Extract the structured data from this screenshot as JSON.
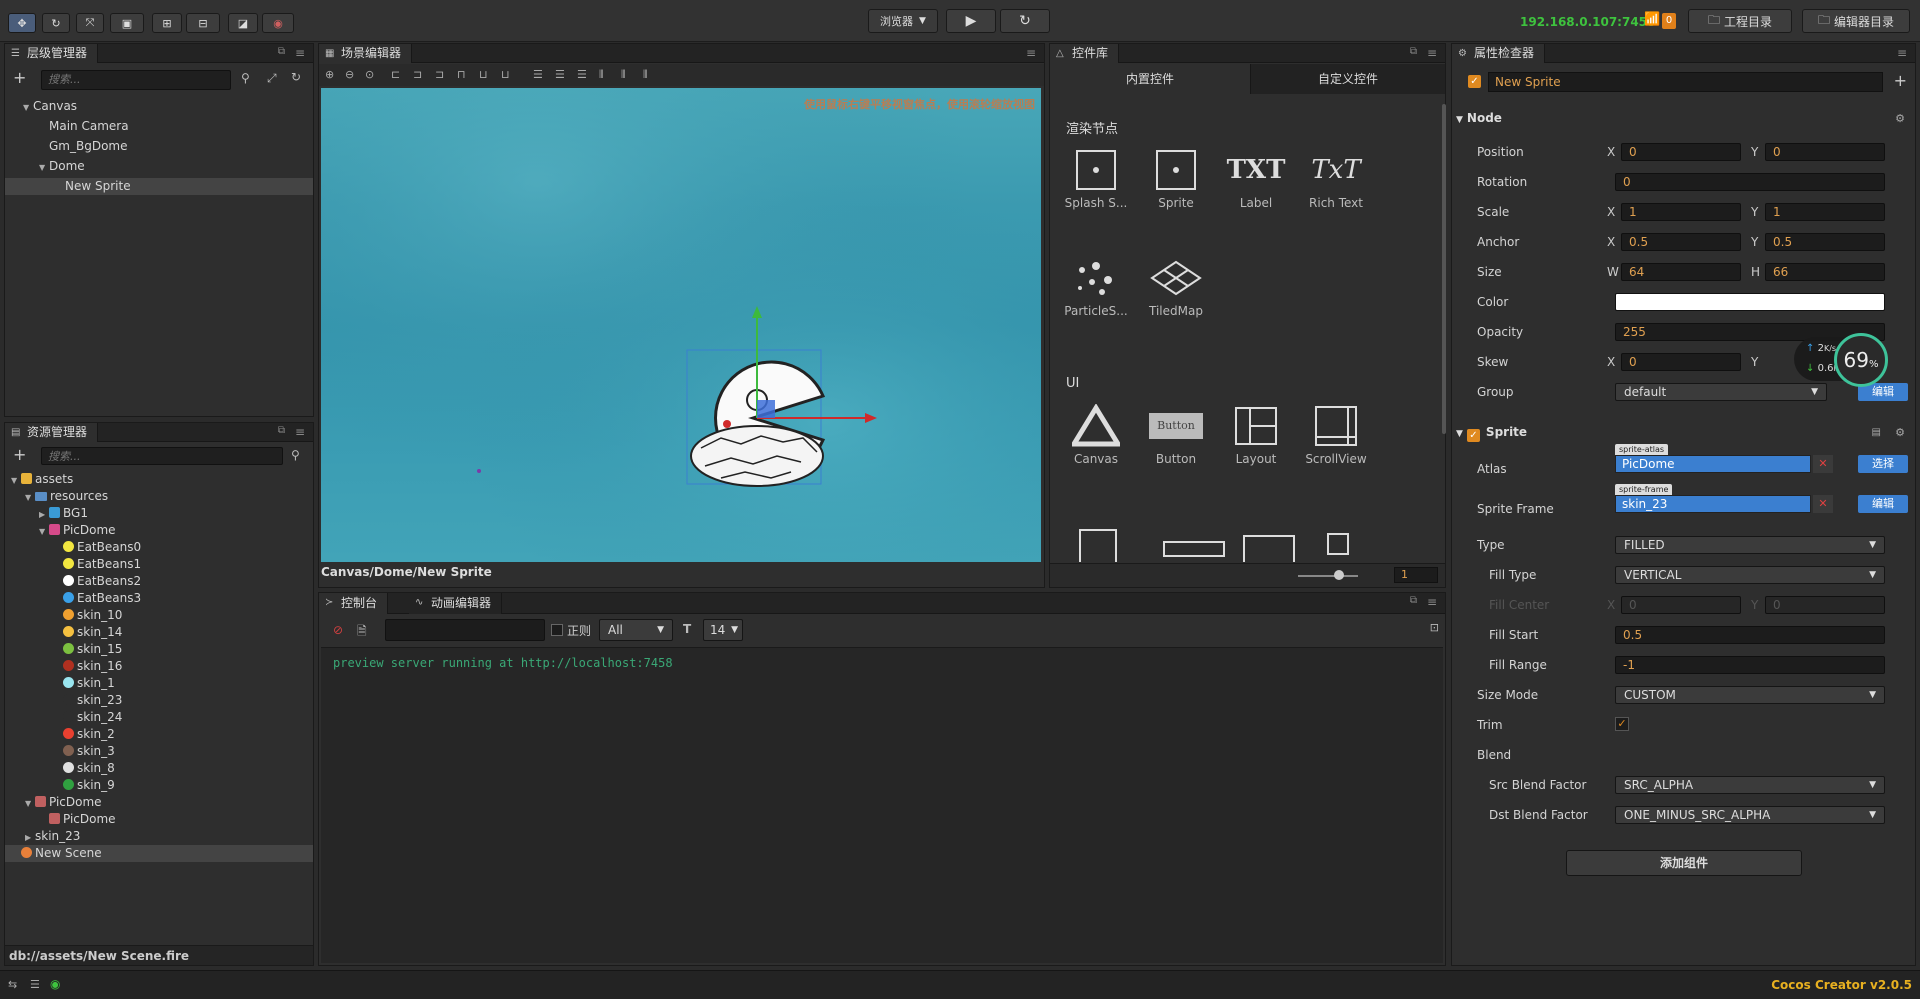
{
  "toolbar": {
    "browser_select": "浏览器",
    "ip_address": "192.168.0.107:7458",
    "notify_count": "0",
    "project_dir": "工程目录",
    "editor_dir": "编辑器目录"
  },
  "hierarchy": {
    "title": "层级管理器",
    "search_placeholder": "搜索...",
    "items": [
      {
        "label": "Canvas",
        "depth": 1,
        "arrow": "▼"
      },
      {
        "label": "Main Camera",
        "depth": 2,
        "arrow": ""
      },
      {
        "label": "Gm_BgDome",
        "depth": 2,
        "arrow": ""
      },
      {
        "label": "Dome",
        "depth": 2,
        "arrow": "▼"
      },
      {
        "label": "New Sprite",
        "depth": 3,
        "arrow": ""
      }
    ]
  },
  "assets": {
    "title": "资源管理器",
    "search_placeholder": "搜索...",
    "path": "db://assets/New Scene.fire",
    "items": [
      {
        "label": "assets",
        "depth": 0,
        "arrow": "▼",
        "icon": "db-icon",
        "color": "#e8b33a"
      },
      {
        "label": "resources",
        "depth": 1,
        "arrow": "▼",
        "icon": "folder-icon",
        "color": "#5a8fc7"
      },
      {
        "label": "BG1",
        "depth": 2,
        "arrow": "▶",
        "icon": "texture-icon",
        "color": "#3a9bd6"
      },
      {
        "label": "PicDome",
        "depth": 2,
        "arrow": "▼",
        "icon": "texture-icon",
        "color": "#d64a8a"
      },
      {
        "label": "EatBeans0",
        "depth": 3,
        "arrow": "",
        "icon": "sprite-icon",
        "color": "#f2e640"
      },
      {
        "label": "EatBeans1",
        "depth": 3,
        "arrow": "",
        "icon": "sprite-icon",
        "color": "#f2e640"
      },
      {
        "label": "EatBeans2",
        "depth": 3,
        "arrow": "",
        "icon": "sprite-icon",
        "color": "#ffffff"
      },
      {
        "label": "EatBeans3",
        "depth": 3,
        "arrow": "",
        "icon": "sprite-icon",
        "color": "#3aa0e8"
      },
      {
        "label": "skin_10",
        "depth": 3,
        "arrow": "",
        "icon": "sprite-icon",
        "color": "#f0a030"
      },
      {
        "label": "skin_14",
        "depth": 3,
        "arrow": "",
        "icon": "sprite-icon",
        "color": "#f5c040"
      },
      {
        "label": "skin_15",
        "depth": 3,
        "arrow": "",
        "icon": "sprite-icon",
        "color": "#7cc040"
      },
      {
        "label": "skin_16",
        "depth": 3,
        "arrow": "",
        "icon": "sprite-icon",
        "color": "#b03020"
      },
      {
        "label": "skin_1",
        "depth": 3,
        "arrow": "",
        "icon": "sprite-icon",
        "color": "#9ae6f0"
      },
      {
        "label": "skin_23",
        "depth": 3,
        "arrow": "",
        "icon": "sprite-icon",
        "color": "#2e2e2e"
      },
      {
        "label": "skin_24",
        "depth": 3,
        "arrow": "",
        "icon": "sprite-icon",
        "color": "#2e2e2e"
      },
      {
        "label": "skin_2",
        "depth": 3,
        "arrow": "",
        "icon": "sprite-icon",
        "color": "#e84030"
      },
      {
        "label": "skin_3",
        "depth": 3,
        "arrow": "",
        "icon": "sprite-icon",
        "color": "#806050"
      },
      {
        "label": "skin_8",
        "depth": 3,
        "arrow": "",
        "icon": "sprite-icon",
        "color": "#e0e0e0"
      },
      {
        "label": "skin_9",
        "depth": 3,
        "arrow": "",
        "icon": "sprite-icon",
        "color": "#30a040"
      },
      {
        "label": "PicDome",
        "depth": 1,
        "arrow": "▼",
        "icon": "atlas-icon",
        "color": "#c06060"
      },
      {
        "label": "PicDome",
        "depth": 2,
        "arrow": "",
        "icon": "atlas-icon",
        "color": "#c06060"
      },
      {
        "label": "skin_23",
        "depth": 1,
        "arrow": "▶",
        "icon": "none",
        "color": "#2e2e2e"
      },
      {
        "label": "New Scene",
        "depth": 0,
        "arrow": "",
        "icon": "scene-icon",
        "color": "#e8803a"
      }
    ]
  },
  "scene": {
    "title": "场景编辑器",
    "hint": "使用鼠标右键平移视窗焦点，使用滚轮缩放视图",
    "breadcrumb": "Canvas/Dome/New Sprite"
  },
  "widgets": {
    "title": "控件库",
    "tab_builtin": "内置控件",
    "tab_custom": "自定义控件",
    "render_header": "渲染节点",
    "ui_header": "UI",
    "render_items": [
      "Splash S...",
      "Sprite",
      "Label",
      "Rich Text",
      "ParticleS...",
      "TiledMap"
    ],
    "ui_items": [
      "Canvas",
      "Button",
      "Layout",
      "ScrollView"
    ],
    "label_glyph": "TXT",
    "richtext_glyph": "TxT",
    "button_glyph": "Button",
    "zoom_value": "1"
  },
  "console": {
    "tab_console": "控制台",
    "tab_animation": "动画编辑器",
    "regex_label": "正则",
    "level_select": "All",
    "font_size": "14",
    "output": "preview server running at http://localhost:7458"
  },
  "inspector": {
    "title": "属性检查器",
    "node_name": "New Sprite",
    "node_section": "Node",
    "position": {
      "label": "Position",
      "x": "0",
      "y": "0"
    },
    "rotation": {
      "label": "Rotation",
      "value": "0"
    },
    "scale": {
      "label": "Scale",
      "x": "1",
      "y": "1"
    },
    "anchor": {
      "label": "Anchor",
      "x": "0.5",
      "y": "0.5"
    },
    "size": {
      "label": "Size",
      "w": "64",
      "h": "66"
    },
    "color": {
      "label": "Color",
      "value": "#ffffff"
    },
    "opacity": {
      "label": "Opacity",
      "value": "255"
    },
    "skew": {
      "label": "Skew",
      "x": "0"
    },
    "group": {
      "label": "Group",
      "value": "default",
      "btn": "编辑"
    },
    "sprite_section": "Sprite",
    "atlas": {
      "label": "Atlas",
      "tag": "sprite-atlas",
      "value": "PicDome",
      "btn": "选择"
    },
    "sprite_frame": {
      "label": "Sprite Frame",
      "tag": "sprite-frame",
      "value": "skin_23",
      "btn": "编辑"
    },
    "type": {
      "label": "Type",
      "value": "FILLED"
    },
    "fill_type": {
      "label": "Fill Type",
      "value": "VERTICAL"
    },
    "fill_center": {
      "label": "Fill Center",
      "x": "0",
      "y": "0"
    },
    "fill_start": {
      "label": "Fill Start",
      "value": "0.5"
    },
    "fill_range": {
      "label": "Fill Range",
      "value": "-1"
    },
    "size_mode": {
      "label": "Size Mode",
      "value": "CUSTOM"
    },
    "trim": {
      "label": "Trim"
    },
    "blend": {
      "label": "Blend"
    },
    "src_blend": {
      "label": "Src Blend Factor",
      "value": "SRC_ALPHA"
    },
    "dst_blend": {
      "label": "Dst Blend Factor",
      "value": "ONE_MINUS_SRC_ALPHA"
    },
    "add_component": "添加组件"
  },
  "perf": {
    "up": "2",
    "down": "0.6",
    "unit": "K/s",
    "percent": "69",
    "percent_sign": "%"
  },
  "status": {
    "version": "Cocos Creator v2.0.5"
  },
  "colors": {
    "accent": "#4a90e2",
    "ip": "#3ec33e",
    "version": "#e8b020",
    "console_text": "#3aa876"
  }
}
